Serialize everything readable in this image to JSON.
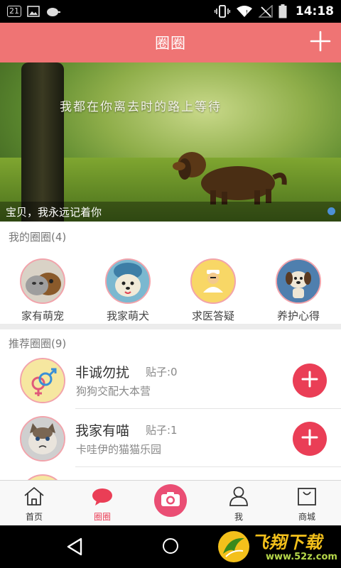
{
  "status_bar": {
    "notification_badge": "21",
    "time": "14:18",
    "icons": [
      "image-icon",
      "cloud-icon",
      "vibrate-icon",
      "wifi-icon",
      "no-signal-icon",
      "battery-icon"
    ]
  },
  "header": {
    "title": "圈圈",
    "add_icon": "plus-icon"
  },
  "banner": {
    "quote": "我都在你离去时的路上等待",
    "caption": "宝贝，我永远记着你",
    "page_indicator": {
      "current": 1,
      "total": 1
    },
    "indicator_color": "#4d90d6"
  },
  "my_circles": {
    "title": "我的圈圈(4)",
    "items": [
      {
        "label": "家有萌宠",
        "icon": "cat-and-dog-avatar"
      },
      {
        "label": "我家萌犬",
        "icon": "puppy-avatar"
      },
      {
        "label": "求医答疑",
        "icon": "vet-doctor-avatar"
      },
      {
        "label": "养护心得",
        "icon": "cartoon-dog-avatar"
      }
    ]
  },
  "recommended": {
    "title": "推荐圈圈(9)",
    "items": [
      {
        "name": "非诚勿扰",
        "posts": "贴子:0",
        "desc": "狗狗交配大本营",
        "icon": "gender-symbols-avatar"
      },
      {
        "name": "我家有喵",
        "posts": "贴子:1",
        "desc": "卡哇伊的猫猫乐园",
        "icon": "grumpy-cat-avatar"
      }
    ]
  },
  "bottom_nav": {
    "items": [
      {
        "label": "首页",
        "icon": "home-icon"
      },
      {
        "label": "圈圈",
        "icon": "chat-bubble-icon",
        "active": true
      },
      {
        "label": "",
        "icon": "camera-icon"
      },
      {
        "label": "我",
        "icon": "person-icon"
      },
      {
        "label": "商城",
        "icon": "shopping-bag-icon"
      }
    ]
  },
  "watermark": {
    "text": "飞翔下载",
    "url": "www.52z.com"
  },
  "colors": {
    "header": "#ef7474",
    "accent": "#ea3e56",
    "avatar_ring": "#f2a3ab",
    "watermark_text": "#f3c01b"
  }
}
